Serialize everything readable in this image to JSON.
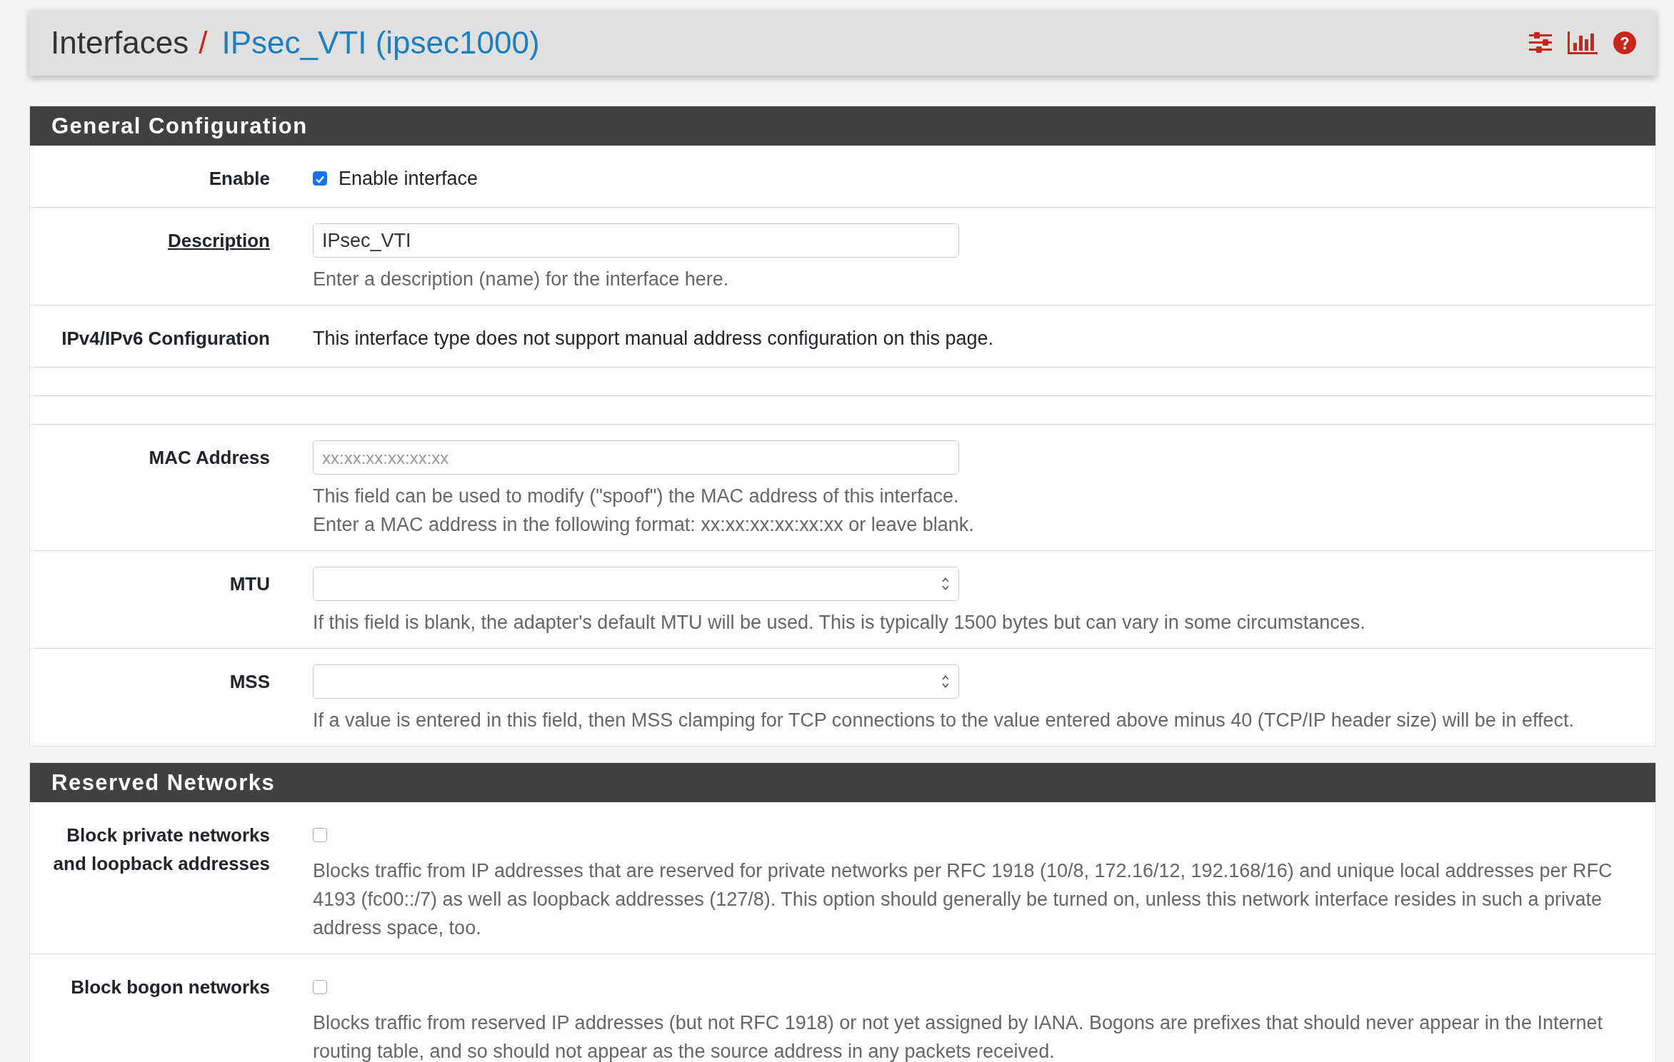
{
  "header": {
    "breadcrumb": "Interfaces",
    "separator": "/",
    "title": "IPsec_VTI (ipsec1000)"
  },
  "sections": [
    {
      "title": "General Configuration",
      "rows": [
        {
          "kind": "checkbox",
          "label": "Enable",
          "checked": true,
          "text": "Enable interface"
        },
        {
          "kind": "input",
          "label": "Description",
          "underlined": true,
          "value": "IPsec_VTI",
          "help": [
            "Enter a description (name) for the interface here."
          ]
        },
        {
          "kind": "text",
          "label": "IPv4/IPv6 Configuration",
          "text": "This interface type does not support manual address configuration on this page."
        },
        {
          "kind": "blank"
        },
        {
          "kind": "blank"
        },
        {
          "kind": "input",
          "label": "MAC Address",
          "placeholder": "xx:xx:xx:xx:xx:xx",
          "help": [
            "This field can be used to modify (\"spoof\") the MAC address of this interface.",
            "Enter a MAC address in the following format: xx:xx:xx:xx:xx:xx or leave blank."
          ]
        },
        {
          "kind": "number",
          "label": "MTU",
          "help": [
            "If this field is blank, the adapter's default MTU will be used. This is typically 1500 bytes but can vary in some circumstances."
          ]
        },
        {
          "kind": "number",
          "label": "MSS",
          "help": [
            "If a value is entered in this field, then MSS clamping for TCP connections to the value entered above minus 40 (TCP/IP header size) will be in effect."
          ]
        }
      ]
    },
    {
      "title": "Reserved Networks",
      "rows": [
        {
          "kind": "checkbox",
          "label": "Block private networks and loopback addresses",
          "checked": false,
          "help": [
            "Blocks traffic from IP addresses that are reserved for private networks per RFC 1918 (10/8, 172.16/12, 192.168/16) and unique local addresses per RFC 4193 (fc00::/7) as well as loopback addresses (127/8). This option should generally be turned on, unless this network interface resides in such a private address space, too."
          ]
        },
        {
          "kind": "checkbox",
          "label": "Block bogon networks",
          "checked": false,
          "help": [
            "Blocks traffic from reserved IP addresses (but not RFC 1918) or not yet assigned by IANA. Bogons are prefixes that should never appear in the Internet routing table, and so should not appear as the source address in any packets received."
          ]
        }
      ]
    }
  ]
}
